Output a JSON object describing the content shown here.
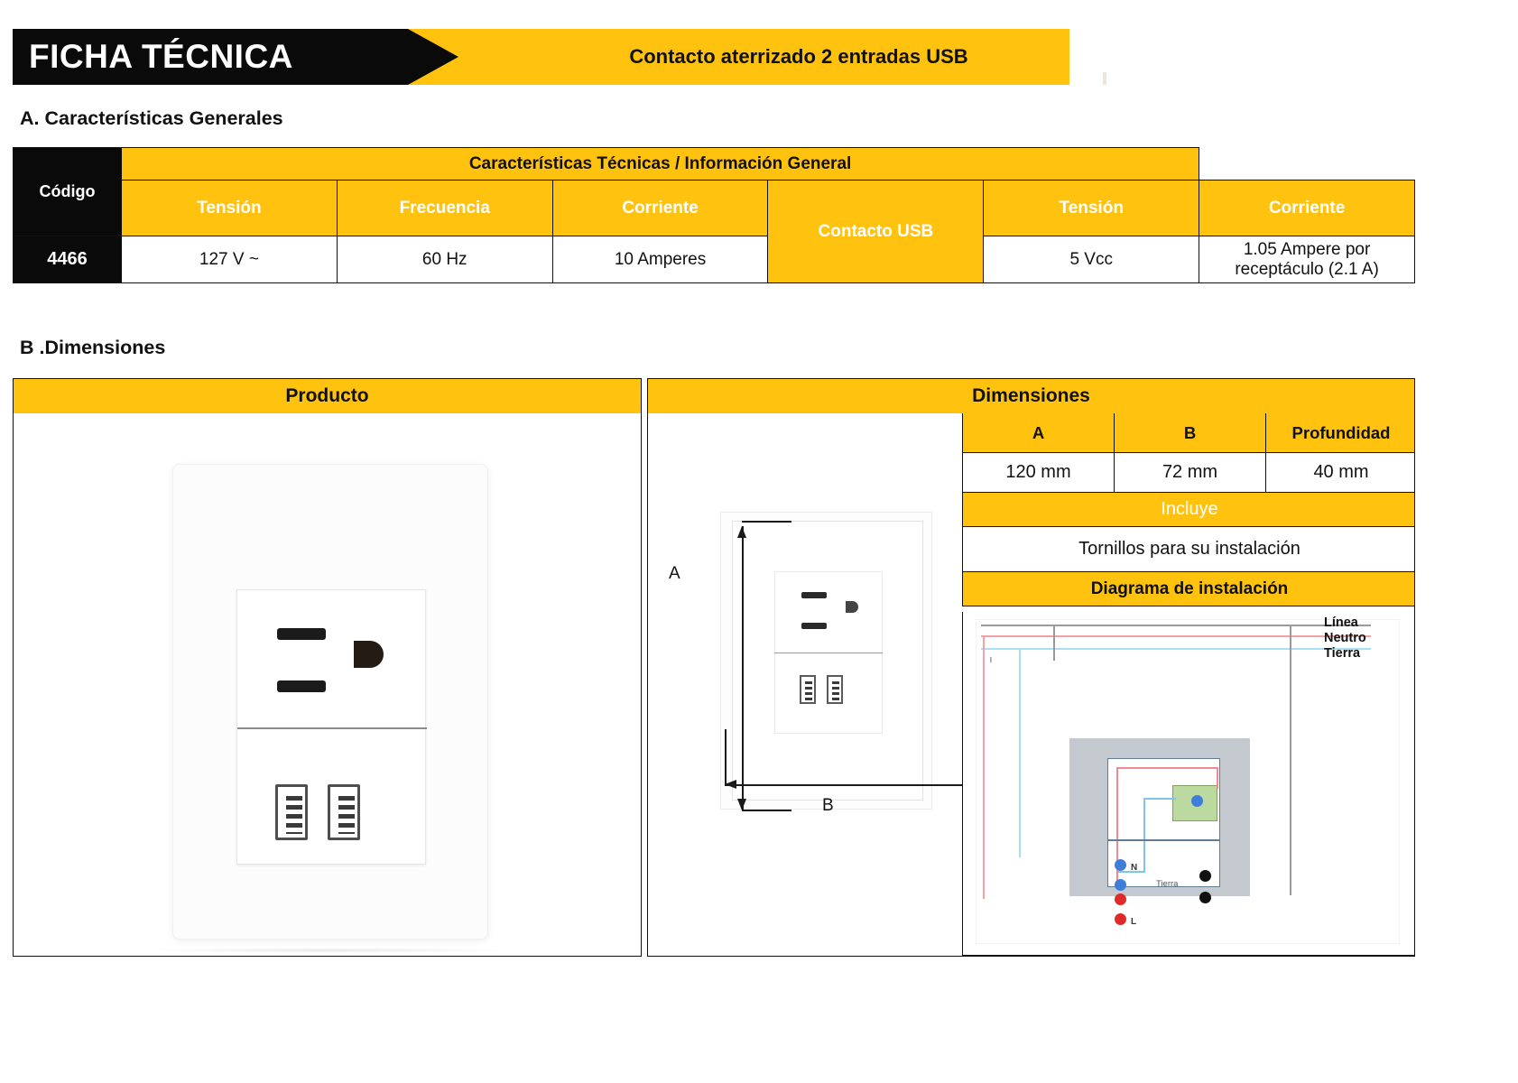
{
  "header": {
    "title": "FICHA TÉCNICA",
    "product_name": "Contacto aterrizado 2 entradas USB",
    "accent_yellow": "#FFC20E",
    "black": "#0a0a0a"
  },
  "sections": {
    "a_title": "A. Características Generales",
    "b_title": "B .Dimensiones"
  },
  "specs_table": {
    "group_header": "Características Técnicas /  Información General",
    "code_label": "Código",
    "code_value": "4466",
    "usb_group_label": "Contacto USB",
    "columns": [
      {
        "header": "Tensión",
        "value": "127 V ~"
      },
      {
        "header": "Frecuencia",
        "value": "60 Hz"
      },
      {
        "header": "Corriente",
        "value": "10 Amperes"
      },
      {
        "header": "Tensión",
        "value": "5 Vcc"
      },
      {
        "header": "Corriente",
        "value": "1.05 Ampere por receptáculo (2.1 A)"
      }
    ]
  },
  "dimensions_block": {
    "product_header": "Producto",
    "dimensions_header": "Dimensiones",
    "dim_columns": [
      "A",
      "B",
      "Profundidad"
    ],
    "dim_values": [
      "120 mm",
      "72 mm",
      "40 mm"
    ],
    "includes_header": "Incluye",
    "includes_value": "Tornillos para su instalación",
    "diagram_header": "Diagrama de instalación"
  },
  "drawing": {
    "label_a": "A",
    "label_b": "B"
  },
  "wiring": {
    "labels": [
      "Línea",
      "Neutro",
      "Tierra"
    ],
    "terminal_n": "N",
    "terminal_l": "L",
    "terminal_ground": "Tierra",
    "left_mark": "l",
    "colors": {
      "line_red": "#f4a0a5",
      "neutral_blue": "#a9dff2",
      "ground_gray": "#9a9a9a",
      "device_body": "#c3c9cf",
      "usb_module": "#bcd9a0"
    }
  }
}
